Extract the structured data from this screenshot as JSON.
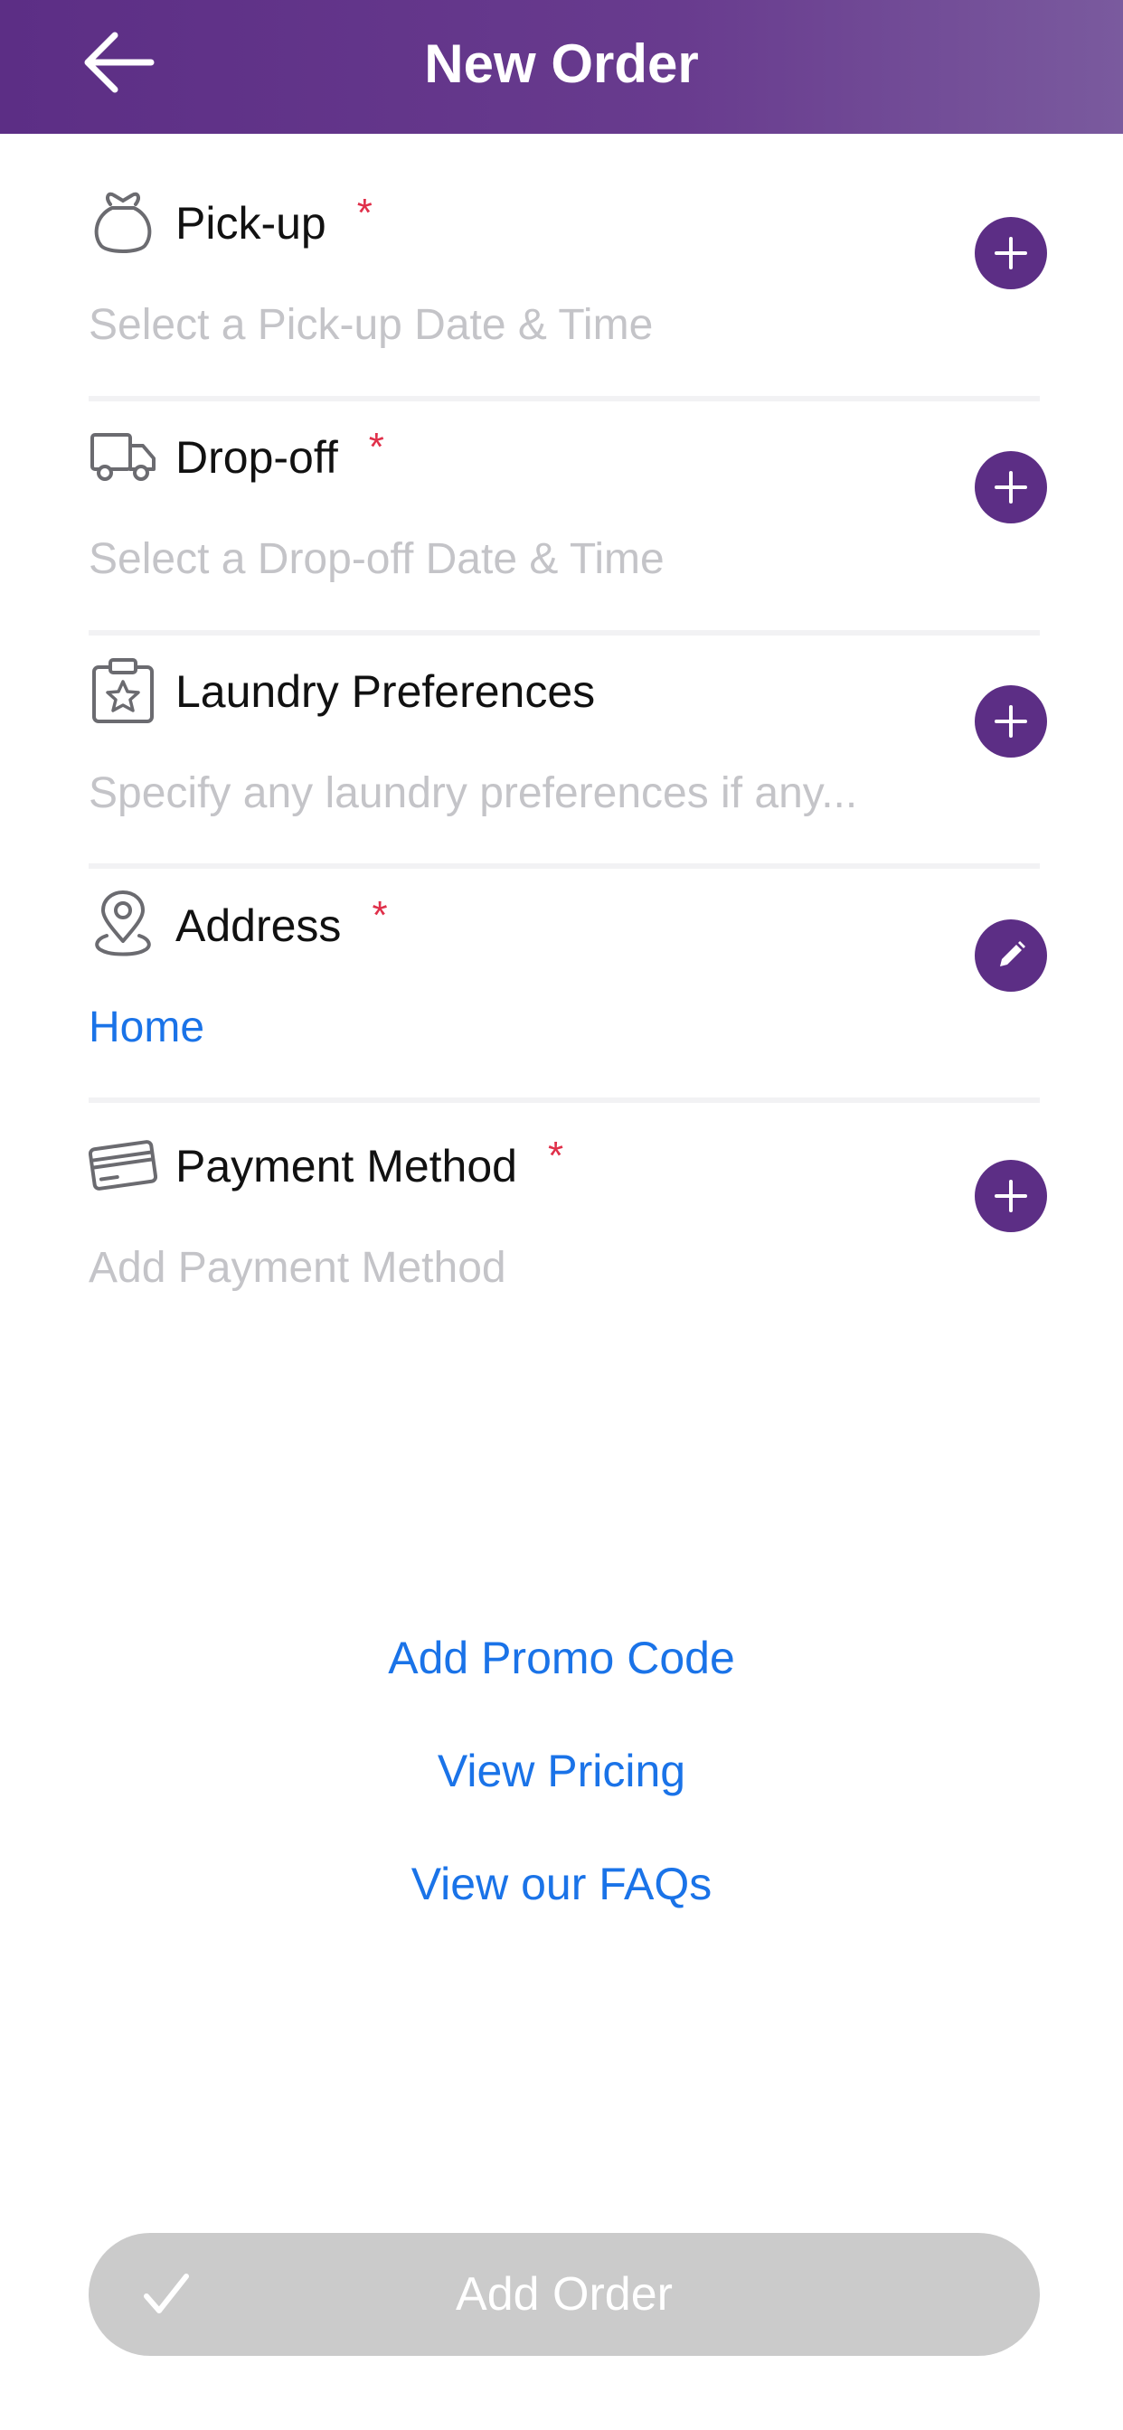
{
  "header": {
    "title": "New Order"
  },
  "sections": [
    {
      "label": "Pick-up",
      "required_mark": "*",
      "value": "Select a Pick-up Date & Time",
      "icon": "laundry-bag-icon",
      "action_icon": "plus-icon"
    },
    {
      "label": "Drop-off",
      "required_mark": "*",
      "value": "Select a Drop-off Date & Time",
      "icon": "truck-icon",
      "action_icon": "plus-icon"
    },
    {
      "label": "Laundry Preferences",
      "value": "Specify any laundry preferences if any...",
      "icon": "clipboard-star-icon",
      "action_icon": "plus-icon"
    },
    {
      "label": "Address",
      "required_mark": "*",
      "value": "Home",
      "icon": "location-pin-icon",
      "action_icon": "pencil-icon"
    },
    {
      "label": "Payment Method",
      "required_mark": "*",
      "value": "Add Payment Method",
      "icon": "credit-card-icon",
      "action_icon": "plus-icon"
    }
  ],
  "links": {
    "promo": "Add Promo Code",
    "pricing": "View Pricing",
    "faqs": "View our FAQs"
  },
  "submit": {
    "label": "Add Order"
  },
  "colors": {
    "header": "#5c2e85",
    "accent_button": "#5c2e85",
    "link": "#1a73e8",
    "required": "#e0304a",
    "placeholder": "#c4c4c8",
    "disabled_button": "#cbcbcb"
  }
}
